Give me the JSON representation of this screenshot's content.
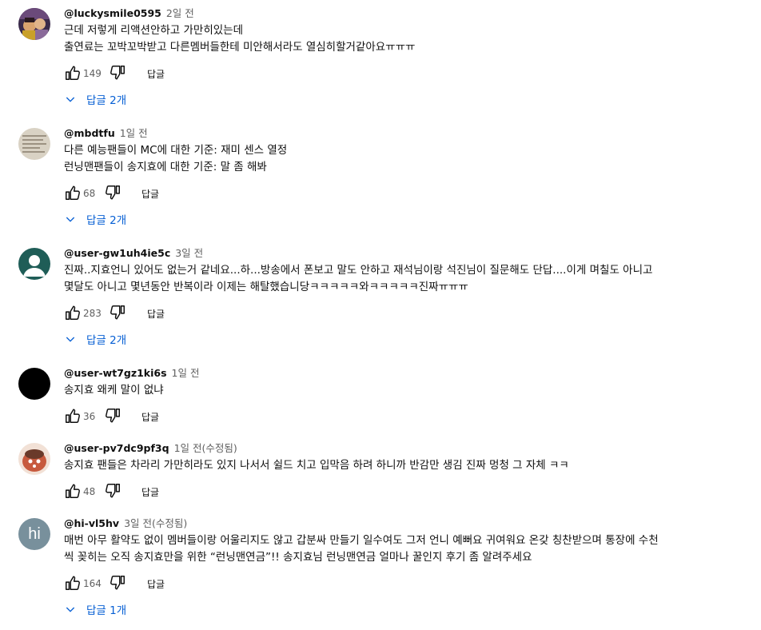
{
  "comments": [
    {
      "author": "@luckysmile0595",
      "time": "2일 전",
      "text": "근데 저렇게 리액션안하고 가만히있는데\n출연료는 꼬박꼬박받고 다른멤버들한테 미안해서라도 열심히할거같아요ㅠㅠㅠ",
      "likes": "149",
      "reply_label": "답글",
      "replies_label": "답글 2개"
    },
    {
      "author": "@mbdtfu",
      "time": "1일 전",
      "text": "다른 예능팬들이 MC에 대한 기준: 재미 센스 열정\n런닝맨팬들이 송지효에 대한 기준: 말 좀 해봐",
      "likes": "68",
      "reply_label": "답글",
      "replies_label": "답글 2개"
    },
    {
      "author": "@user-gw1uh4ie5c",
      "time": "3일 전",
      "text": "진짜..지효언니 있어도 없는거 같네요...하...방송에서 폰보고 말도 안하고 재석님이랑 석진님이 질문해도 단답....이게 며칠도 아니고\n몇달도 아니고 몇년동안 반복이라 이제는 해탈했습니당ㅋㅋㅋㅋㅋ와ㅋㅋㅋㅋㅋ진짜ㅠㅠㅠ",
      "likes": "283",
      "reply_label": "답글",
      "replies_label": "답글 2개"
    },
    {
      "author": "@user-wt7gz1ki6s",
      "time": "1일 전",
      "text": "송지효 왜케 말이 없냐",
      "likes": "36",
      "reply_label": "답글"
    },
    {
      "author": "@user-pv7dc9pf3q",
      "time": "1일 전(수정됨)",
      "text": "송지효 팬들은 차라리 가만히라도 있지 나서서 쉴드 치고 입막음 하려 하니까 반감만 생김 진짜 멍청 그 자체 ㅋㅋ",
      "likes": "48",
      "reply_label": "답글"
    },
    {
      "author": "@hi-vl5hv",
      "time": "3일 전(수정됨)",
      "avatar_text": "hi",
      "text": "매번 아무 활약도 없이 멤버들이랑 어울리지도 않고 갑분싸 만들기 일수여도 그저 언니 예뻐요 귀여워요 온갖 칭찬받으며 통장에 수천\n씩 꽂히는 오직 송지효만을 위한 “런닝맨연금”!! 송지효님 런닝맨연금 얼마나 꿀인지 후기 좀 알려주세요",
      "likes": "164",
      "reply_label": "답글",
      "replies_label": "답글 1개"
    }
  ],
  "icons": {
    "like": "thumbs-up-icon",
    "dislike": "thumbs-down-icon",
    "expand": "chevron-down-icon"
  },
  "colors": {
    "link_blue": "#065fd4",
    "meta_gray": "#606060",
    "avatar_teal": "#1f5d57",
    "avatar_slate": "#78909c"
  }
}
